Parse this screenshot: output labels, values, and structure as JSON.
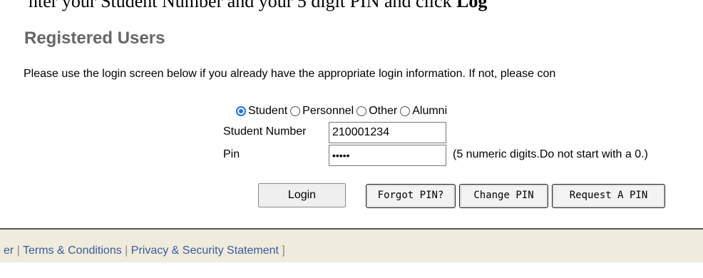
{
  "top_clip": {
    "prefix": "nter your Student Number and your 5 digit PIN and click ",
    "bold": "Log"
  },
  "heading": "Registered Users",
  "intro": "Please use the login screen below if you already have the appropriate login information. If not, please con",
  "radios": [
    {
      "label": "Student",
      "checked": true
    },
    {
      "label": "Personnel",
      "checked": false
    },
    {
      "label": "Other",
      "checked": false
    },
    {
      "label": "Alumni",
      "checked": false
    }
  ],
  "form": {
    "student_number_label": "Student Number",
    "student_number_value": "210001234",
    "pin_label": "Pin",
    "pin_value": "•••••",
    "pin_hint": "(5 numeric digits.Do not start with a 0.)"
  },
  "buttons": {
    "login": "Login",
    "forgot_pin": "Forgot PIN?",
    "change_pin": "Change PIN",
    "request_pin": "Request A PIN"
  },
  "footer": {
    "partial_link": "er",
    "sep1": " | ",
    "terms": "Terms & Conditions",
    "sep2": " | ",
    "privacy": "Privacy & Security Statement",
    "end": " ]"
  }
}
